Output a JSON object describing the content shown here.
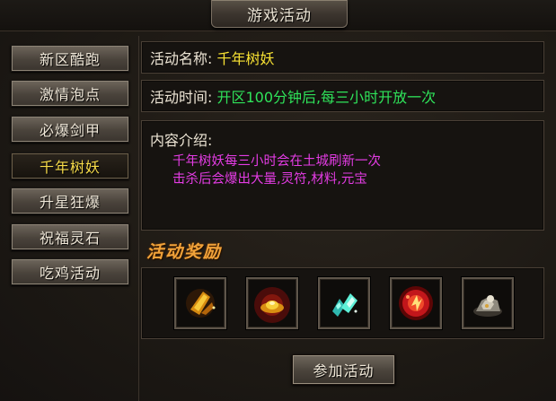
{
  "window": {
    "title": "游戏活动"
  },
  "menu": {
    "items": [
      {
        "label": "新区酷跑",
        "active": false
      },
      {
        "label": "激情泡点",
        "active": false
      },
      {
        "label": "必爆剑甲",
        "active": false
      },
      {
        "label": "千年树妖",
        "active": true
      },
      {
        "label": "升星狂爆",
        "active": false
      },
      {
        "label": "祝福灵石",
        "active": false
      },
      {
        "label": "吃鸡活动",
        "active": false
      }
    ]
  },
  "activity": {
    "name_label": "活动名称:",
    "name_value": "千年树妖",
    "time_label": "活动时间:",
    "time_value": "开区100分钟后,每三小时开放一次",
    "intro_label": "内容介绍:",
    "intro_lines": [
      "千年树妖每三小时会在土城刷新一次",
      "击杀后会爆出大量,灵符,材料,元宝"
    ]
  },
  "rewards": {
    "title": "活动奖励",
    "items": [
      {
        "icon": "gold-talisman-icon",
        "color": "#e8a417"
      },
      {
        "icon": "gold-ingot-icon",
        "color": "#f2b21e"
      },
      {
        "icon": "crystal-material-icon",
        "color": "#3fd8c4"
      },
      {
        "icon": "fire-orb-icon",
        "color": "#e8242a"
      },
      {
        "icon": "ore-pile-icon",
        "color": "#bdb7a8"
      }
    ]
  },
  "actions": {
    "join_label": "参加活动"
  }
}
